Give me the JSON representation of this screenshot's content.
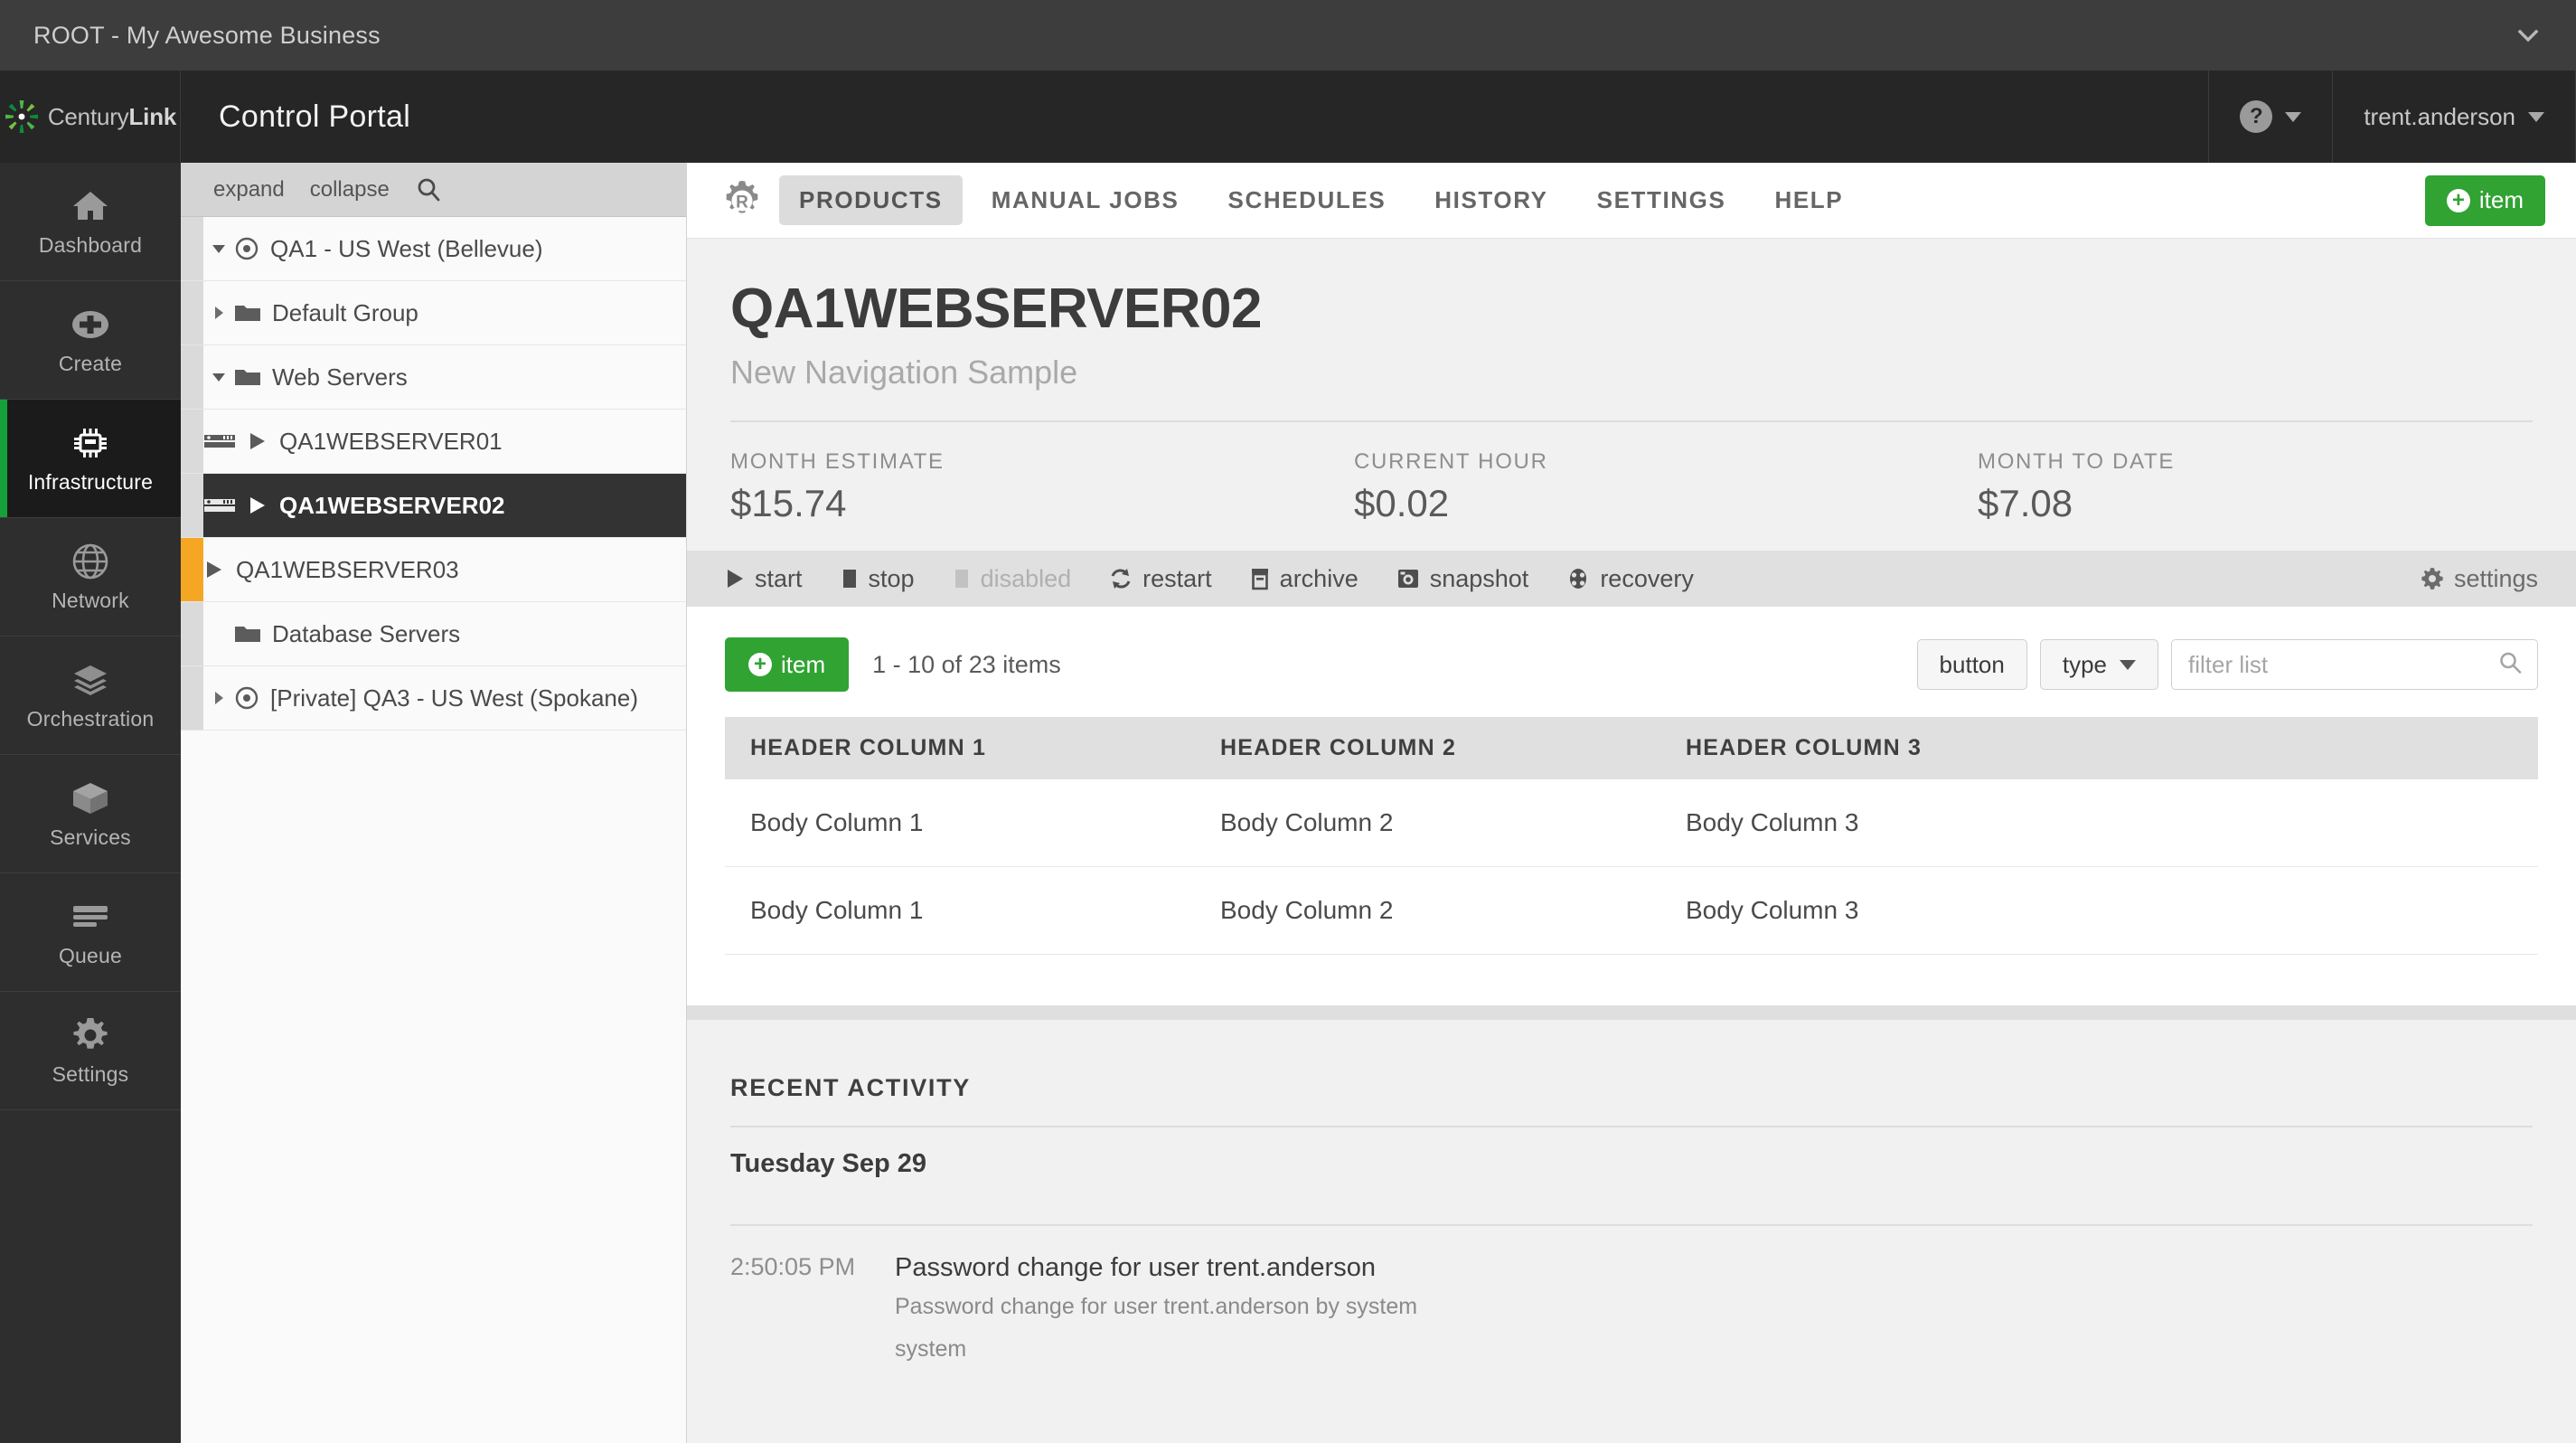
{
  "account_bar": {
    "title": "ROOT - My Awesome Business",
    "chevron_icon": "chevron-down-icon"
  },
  "brand": {
    "logo_text_a": "Century",
    "logo_text_b": "Link",
    "portal_title": "Control Portal",
    "help_glyph": "?",
    "user_name": "trent.anderson"
  },
  "rail": {
    "items": [
      {
        "label": "Dashboard",
        "icon": "home-icon",
        "active": false
      },
      {
        "label": "Create",
        "icon": "plus-circle-icon",
        "active": false
      },
      {
        "label": "Infrastructure",
        "icon": "chip-icon",
        "active": true
      },
      {
        "label": "Network",
        "icon": "globe-icon",
        "active": false
      },
      {
        "label": "Orchestration",
        "icon": "layers-icon",
        "active": false
      },
      {
        "label": "Services",
        "icon": "box-icon",
        "active": false
      },
      {
        "label": "Queue",
        "icon": "queue-icon",
        "active": false
      },
      {
        "label": "Settings",
        "icon": "gear-icon",
        "active": false
      }
    ]
  },
  "tree": {
    "toolbar": {
      "expand": "expand",
      "collapse": "collapse",
      "search_icon": "search-icon"
    },
    "rows": [
      {
        "label": "QA1 - US West (Bellevue)",
        "indent": "indent-0",
        "disclosure": "down",
        "icon": "datacenter-icon",
        "selected": false,
        "warn": false
      },
      {
        "label": "Default Group",
        "indent": "indent-1",
        "disclosure": "right",
        "icon": "folder-icon",
        "selected": false,
        "warn": false
      },
      {
        "label": "Web Servers",
        "indent": "indent-1",
        "disclosure": "down",
        "icon": "folder-icon",
        "selected": false,
        "warn": false
      },
      {
        "label": "QA1WEBSERVER01",
        "indent": "indent-2",
        "disclosure": "none",
        "icon": "server-running-icon",
        "selected": false,
        "warn": false
      },
      {
        "label": "QA1WEBSERVER02",
        "indent": "indent-2",
        "disclosure": "none",
        "icon": "server-running-icon",
        "selected": true,
        "warn": false
      },
      {
        "label": "QA1WEBSERVER03",
        "indent": "indent-2b",
        "disclosure": "none",
        "icon": "play-icon",
        "selected": false,
        "warn": true
      },
      {
        "label": "Database Servers",
        "indent": "indent-1",
        "disclosure": "none",
        "icon": "folder-icon",
        "selected": false,
        "warn": false
      },
      {
        "label": "[Private] QA3 - US West (Spokane)",
        "indent": "indent-0",
        "disclosure": "right",
        "icon": "datacenter-icon",
        "selected": false,
        "warn": false
      }
    ]
  },
  "tabs": {
    "gear_icon": "gear-r-icon",
    "items": [
      {
        "label": "PRODUCTS",
        "active": true
      },
      {
        "label": "MANUAL JOBS",
        "active": false
      },
      {
        "label": "SCHEDULES",
        "active": false
      },
      {
        "label": "HISTORY",
        "active": false
      },
      {
        "label": "SETTINGS",
        "active": false
      },
      {
        "label": "HELP",
        "active": false
      }
    ],
    "add_item_label": "item"
  },
  "page": {
    "title": "QA1WEBSERVER02",
    "subtitle": "New Navigation Sample"
  },
  "stats": [
    {
      "label": "MONTH ESTIMATE",
      "value": "$15.74"
    },
    {
      "label": "CURRENT HOUR",
      "value": "$0.02"
    },
    {
      "label": "MONTH TO DATE",
      "value": "$7.08"
    }
  ],
  "actions": [
    {
      "label": "start",
      "icon": "play-icon",
      "disabled": false
    },
    {
      "label": "stop",
      "icon": "stop-icon",
      "disabled": false
    },
    {
      "label": "disabled",
      "icon": "stop-icon",
      "disabled": true
    },
    {
      "label": "restart",
      "icon": "restart-icon",
      "disabled": false
    },
    {
      "label": "archive",
      "icon": "archive-icon",
      "disabled": false
    },
    {
      "label": "snapshot",
      "icon": "camera-icon",
      "disabled": false
    },
    {
      "label": "recovery",
      "icon": "recovery-icon",
      "disabled": false
    }
  ],
  "settings_action": {
    "label": "settings",
    "icon": "gear-icon"
  },
  "list": {
    "add_item_label": "item",
    "count_text": "1 - 10 of 23 items",
    "button_label": "button",
    "type_label": "type",
    "filter_placeholder": "filter list",
    "filter_value": "",
    "filter_icon": "search-icon"
  },
  "table": {
    "headers": [
      "HEADER COLUMN 1",
      "HEADER COLUMN 2",
      "HEADER COLUMN 3"
    ],
    "rows": [
      [
        "Body Column 1",
        "Body Column 2",
        "Body Column 3"
      ],
      [
        "Body Column 1",
        "Body Column 2",
        "Body Column 3"
      ]
    ]
  },
  "activity": {
    "title": "RECENT ACTIVITY",
    "day": "Tuesday Sep 29",
    "entries": [
      {
        "time": "2:50:05 PM",
        "title": "Password change for user trent.anderson",
        "description": "Password change for user trent.anderson by system",
        "who": "system"
      }
    ]
  },
  "colors": {
    "accent_green": "#30a333",
    "warning_orange": "#f5a623",
    "rail_active_bar": "#16a03c"
  }
}
